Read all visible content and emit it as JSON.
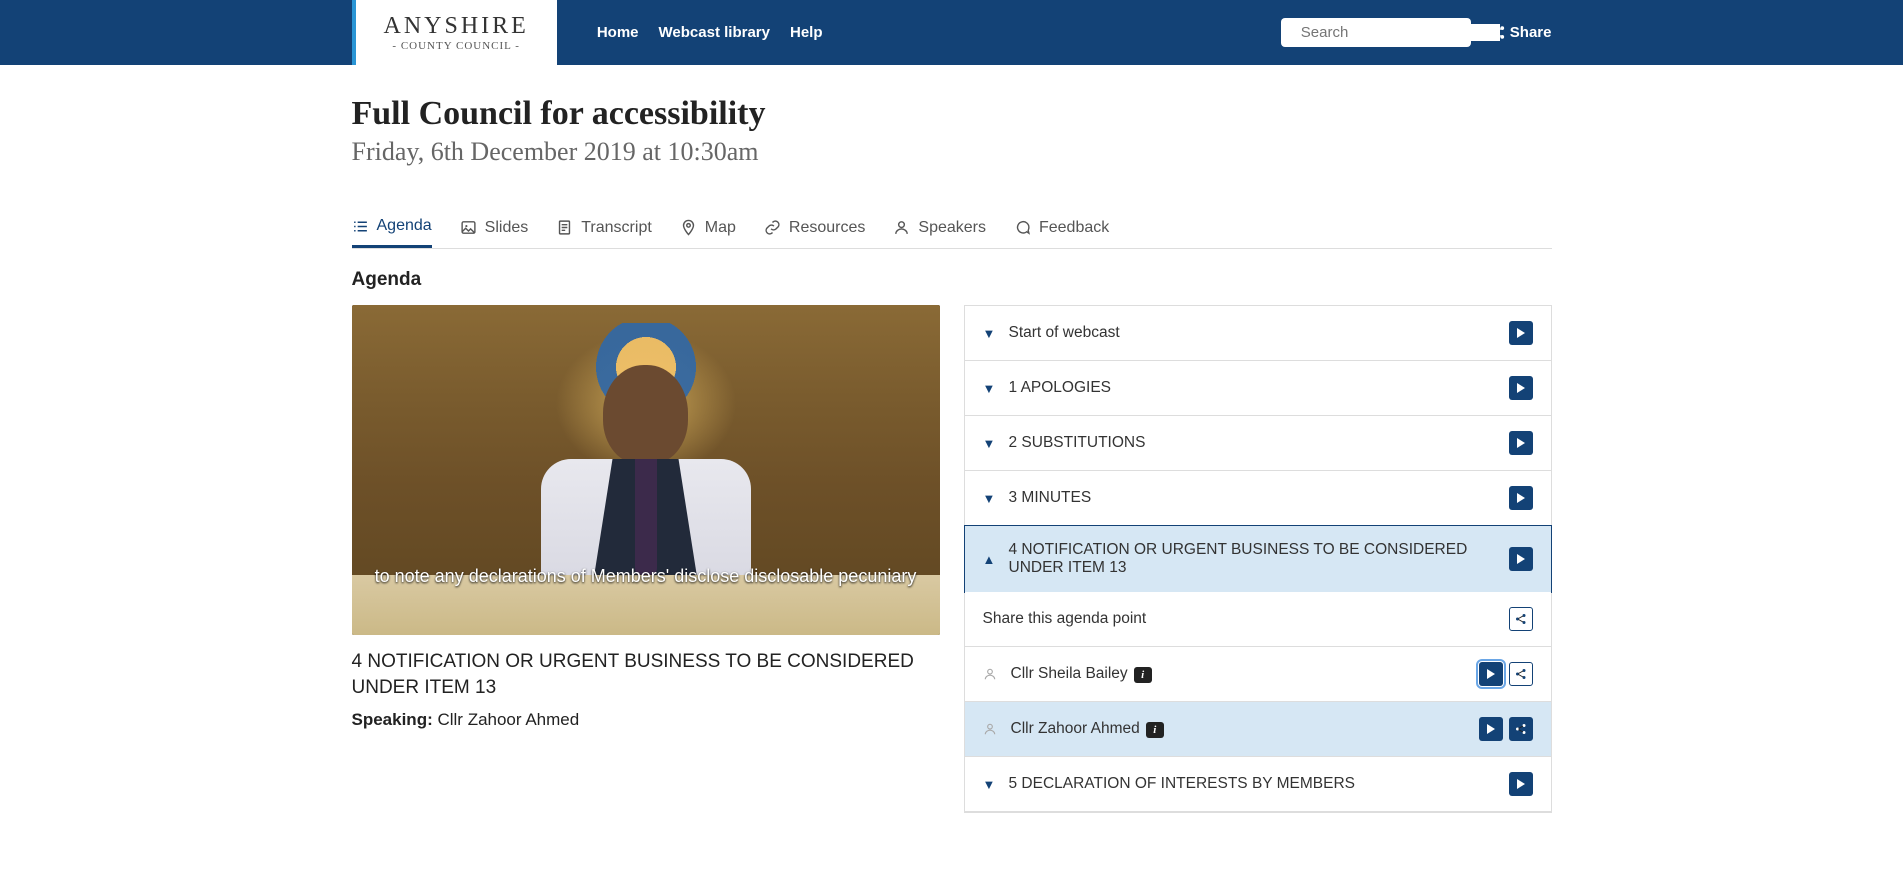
{
  "header": {
    "logo_main": "ANYSHIRE",
    "logo_sub": "- COUNTY COUNCIL -",
    "nav": [
      "Home",
      "Webcast library",
      "Help"
    ],
    "search_placeholder": "Search",
    "share": "Share"
  },
  "page": {
    "title": "Full Council for accessibility",
    "subtitle": "Friday, 6th December 2019 at 10:30am"
  },
  "tabs": [
    {
      "icon": "list",
      "label": "Agenda",
      "active": true
    },
    {
      "icon": "image",
      "label": "Slides"
    },
    {
      "icon": "doc",
      "label": "Transcript"
    },
    {
      "icon": "pin",
      "label": "Map"
    },
    {
      "icon": "link",
      "label": "Resources"
    },
    {
      "icon": "user",
      "label": "Speakers"
    },
    {
      "icon": "chat",
      "label": "Feedback"
    }
  ],
  "section_title": "Agenda",
  "video": {
    "caption": "to note any declarations of Members' disclose disclosable pecuniary",
    "current_item_title": "4 NOTIFICATION OR URGENT BUSINESS TO BE CONSIDERED UNDER ITEM 13",
    "speaking_label": "Speaking:",
    "speaking_name": " Cllr Zahoor Ahmed"
  },
  "agenda": {
    "items": [
      {
        "label": "Start of webcast"
      },
      {
        "label": "1 APOLOGIES"
      },
      {
        "label": "2 SUBSTITUTIONS"
      },
      {
        "label": "3 MINUTES"
      },
      {
        "label": "4 NOTIFICATION OR URGENT BUSINESS TO BE CONSIDERED UNDER ITEM 13",
        "active": true
      },
      {
        "label": "5 DECLARATION OF INTERESTS BY MEMBERS"
      }
    ],
    "share_text": "Share this agenda point",
    "speakers": [
      {
        "name": "Cllr Sheila Bailey"
      },
      {
        "name": "Cllr Zahoor Ahmed",
        "hi": true
      }
    ]
  }
}
